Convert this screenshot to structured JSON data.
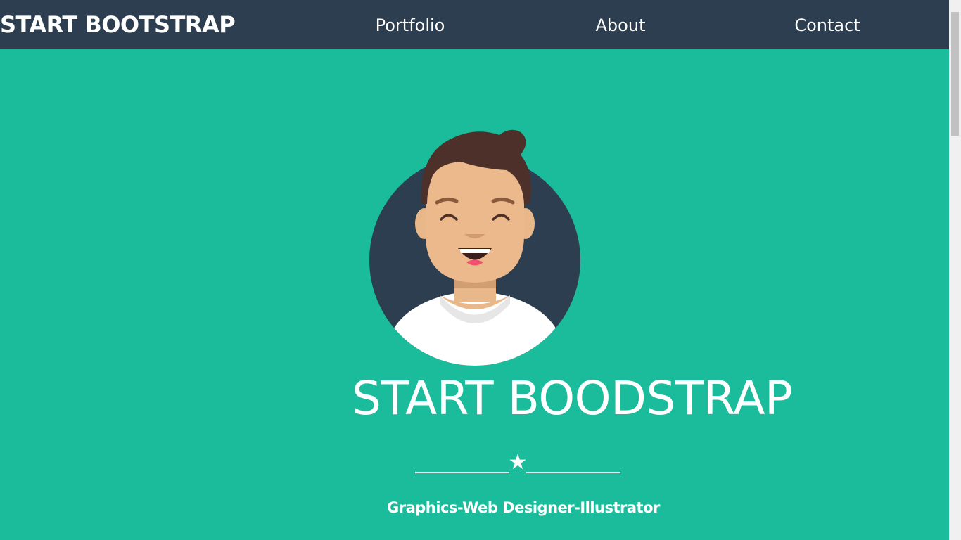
{
  "navbar": {
    "brand": "START BOOTSTRAP",
    "links": [
      "Portfolio",
      "About",
      "Contact"
    ]
  },
  "hero": {
    "title": "START BOODSTRAP",
    "divider_icon": "star-icon",
    "divider_glyph": "★",
    "subtitle": "Graphics-Web Designer-Illustrator"
  },
  "colors": {
    "navbar_bg": "#2c3e50",
    "hero_bg": "#1abc9c",
    "text": "#ffffff"
  }
}
